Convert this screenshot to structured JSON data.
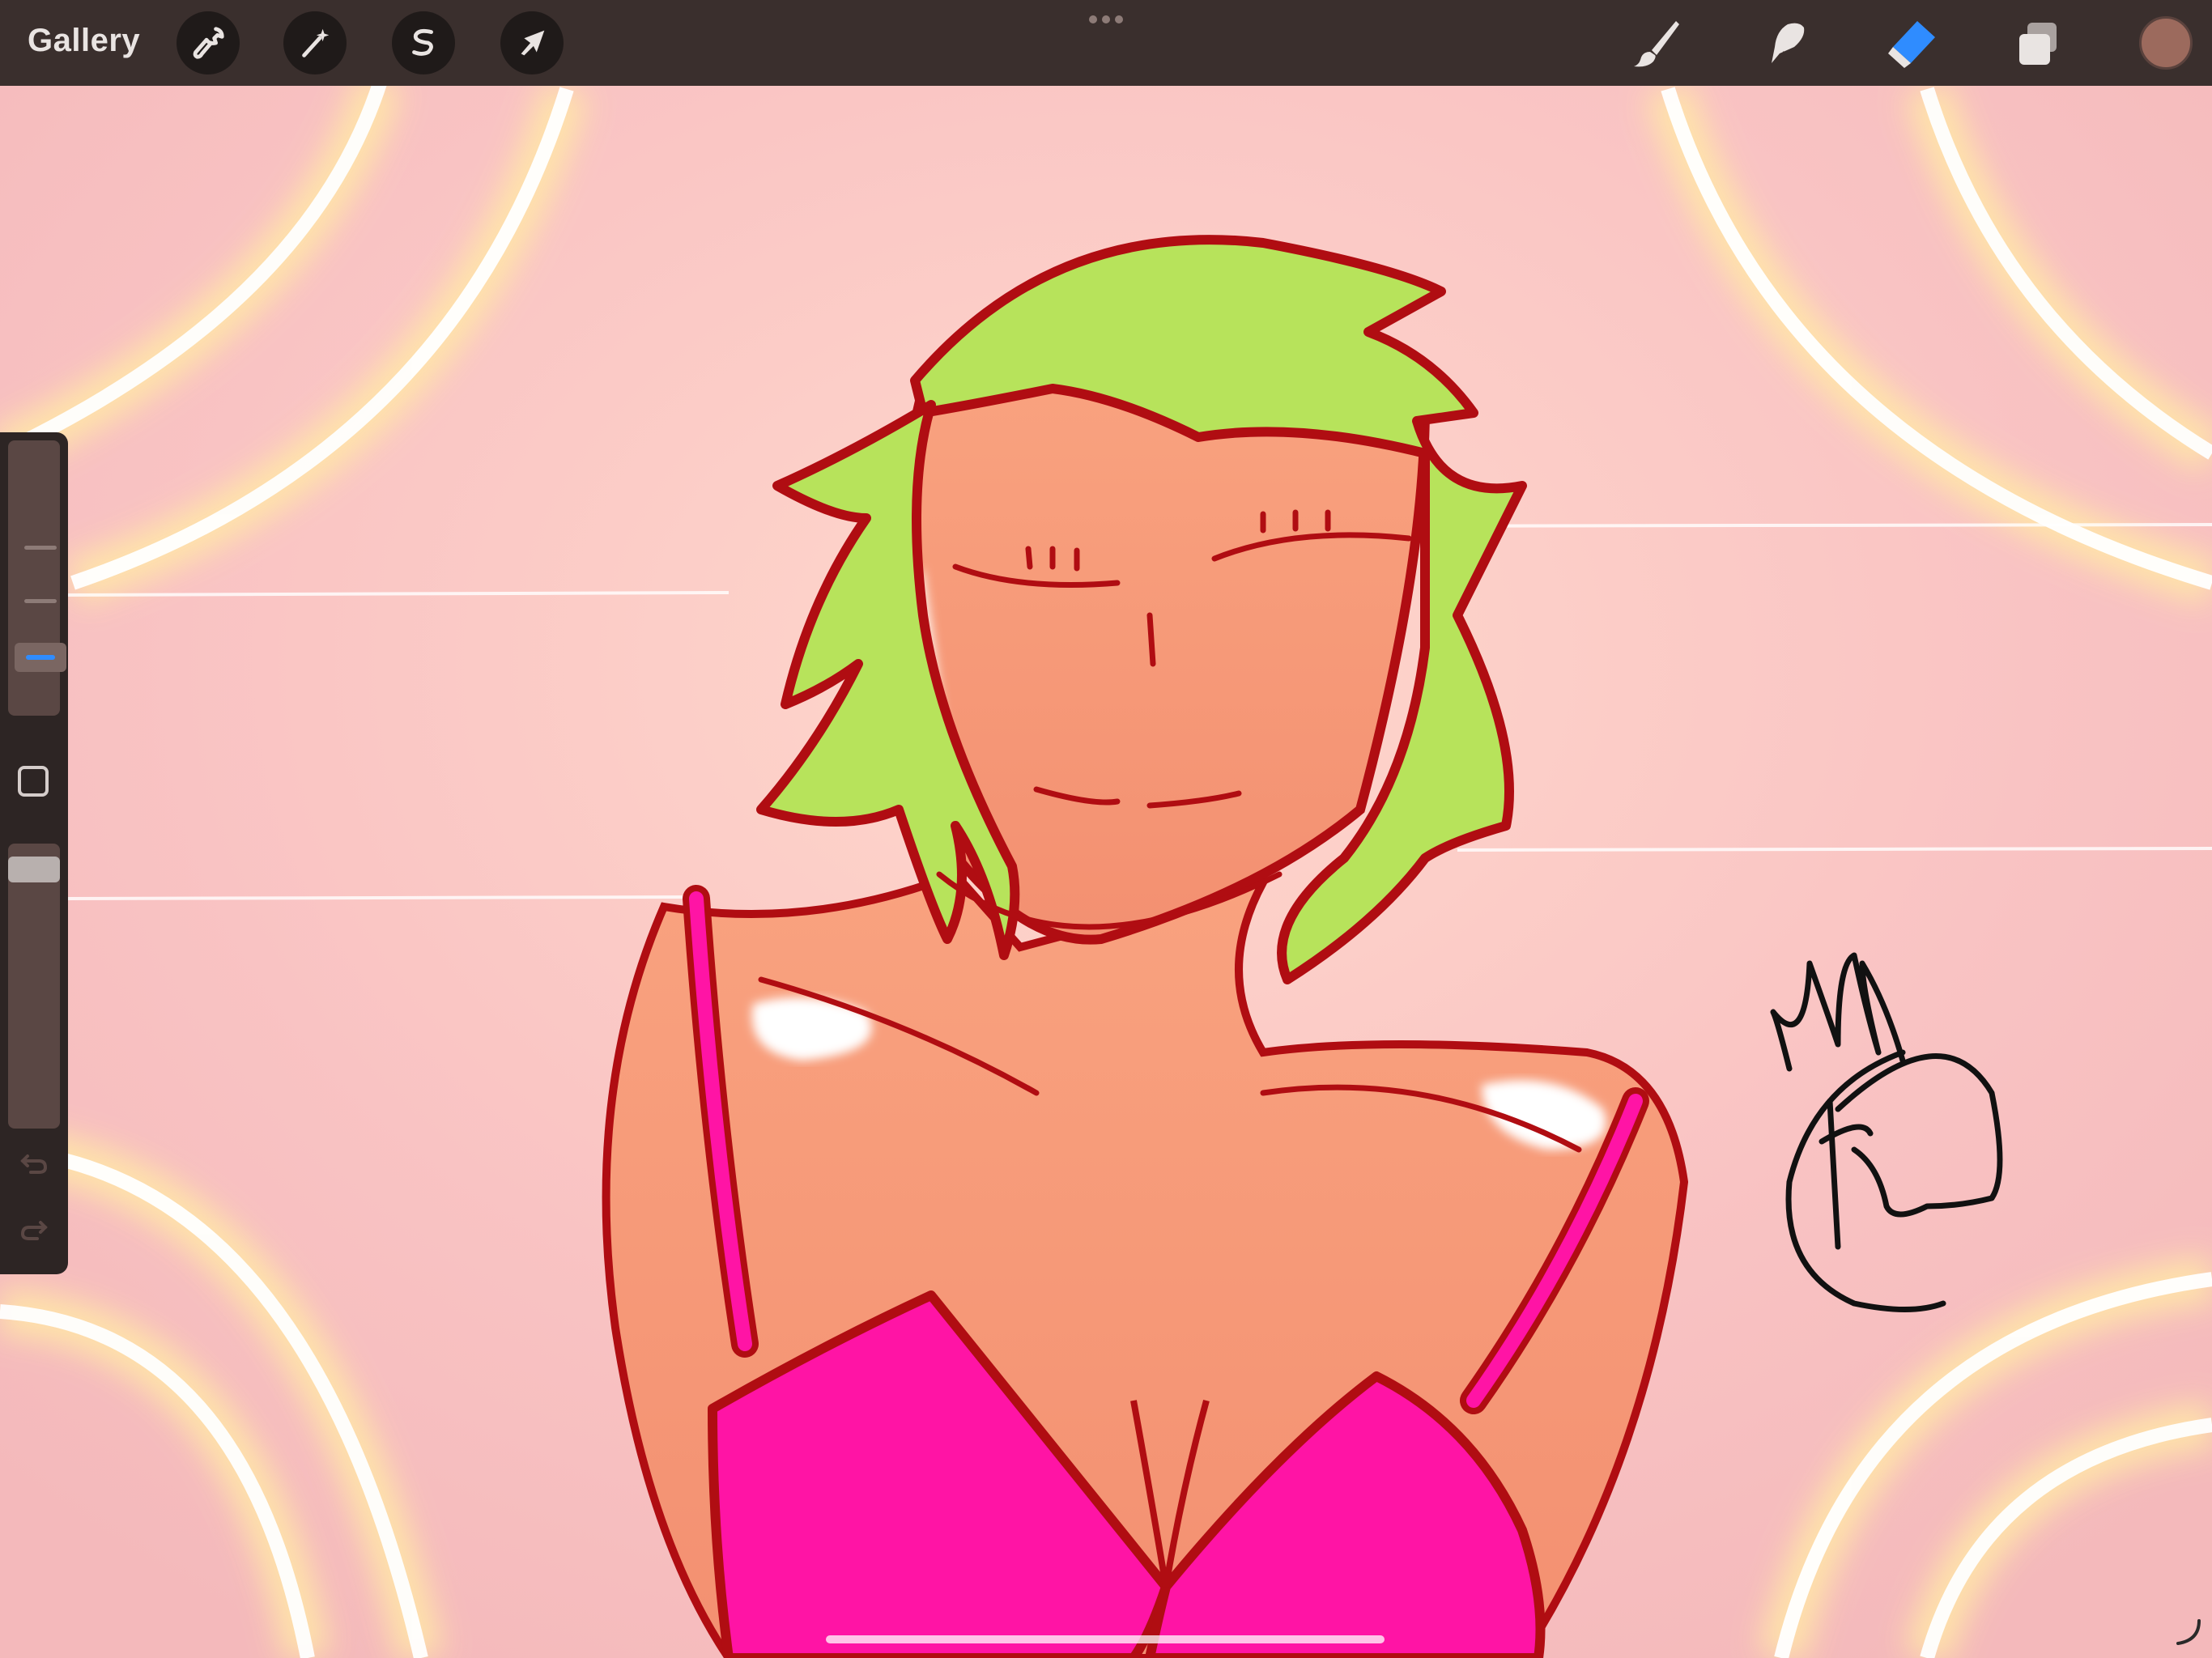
{
  "toolbar": {
    "gallery_label": "Gallery",
    "left_tools": [
      {
        "name": "actions",
        "icon": "wrench-icon"
      },
      {
        "name": "adjustments",
        "icon": "magic-wand-icon"
      },
      {
        "name": "selection",
        "icon": "selection-s-icon"
      },
      {
        "name": "transform",
        "icon": "arrow-cursor-icon"
      }
    ],
    "right_tools": [
      {
        "name": "brush",
        "icon": "brush-icon",
        "active": false
      },
      {
        "name": "smudge",
        "icon": "smudge-icon",
        "active": false
      },
      {
        "name": "eraser",
        "icon": "eraser-icon",
        "active": true
      },
      {
        "name": "layers",
        "icon": "layers-icon",
        "active": false
      }
    ],
    "current_color": "#9c6a5d",
    "active_tool_color": "#2f8cff"
  },
  "sidebar": {
    "size_slider_value": 0.25,
    "opacity_slider_value": 1.0,
    "icons": [
      "square-modify-icon",
      "undo-icon",
      "redo-icon"
    ]
  },
  "canvas": {
    "background_color": "#f7c2c2",
    "skin_color": "#f59a78",
    "hair_color": "#b7e35b",
    "outline_color": "#b00d12",
    "top_color": "#ff14a5"
  }
}
